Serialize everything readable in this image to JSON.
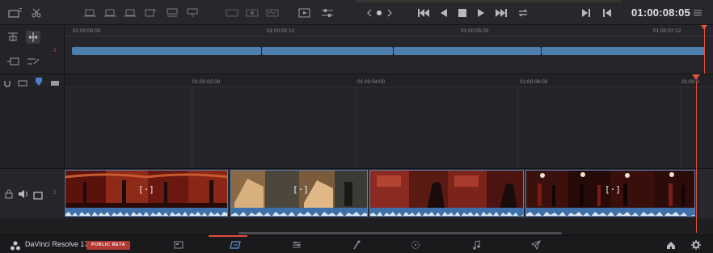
{
  "transport": {
    "timecode": "01:00:08:05"
  },
  "upper_track": {
    "track_number": "1"
  },
  "upper_ruler": {
    "labels": [
      "01:00:00:00",
      "01:00:02:12",
      "01:00:05:00",
      "01:00:07:12"
    ]
  },
  "lower_ruler": {
    "labels": [
      "01:00:02:00",
      "01:00:04:00",
      "01:00:06:00",
      "01:00:0"
    ]
  },
  "video_track": {
    "track_number": "1"
  },
  "clips": [
    {
      "marker": "[·]"
    },
    {
      "marker": "[·]"
    },
    {
      "marker": ""
    },
    {
      "marker": "[·]"
    }
  ],
  "page_nav": {
    "app_name": "DaVinci Resolve 17",
    "badge": "PUBLIC BETA",
    "pages": [
      "media",
      "cut",
      "edit",
      "fusion",
      "color",
      "fairlight",
      "deliver"
    ],
    "active_page": "cut"
  },
  "colors": {
    "accent": "#e5503f",
    "clip_blue": "#4e7ead",
    "badge": "#b23a35"
  }
}
